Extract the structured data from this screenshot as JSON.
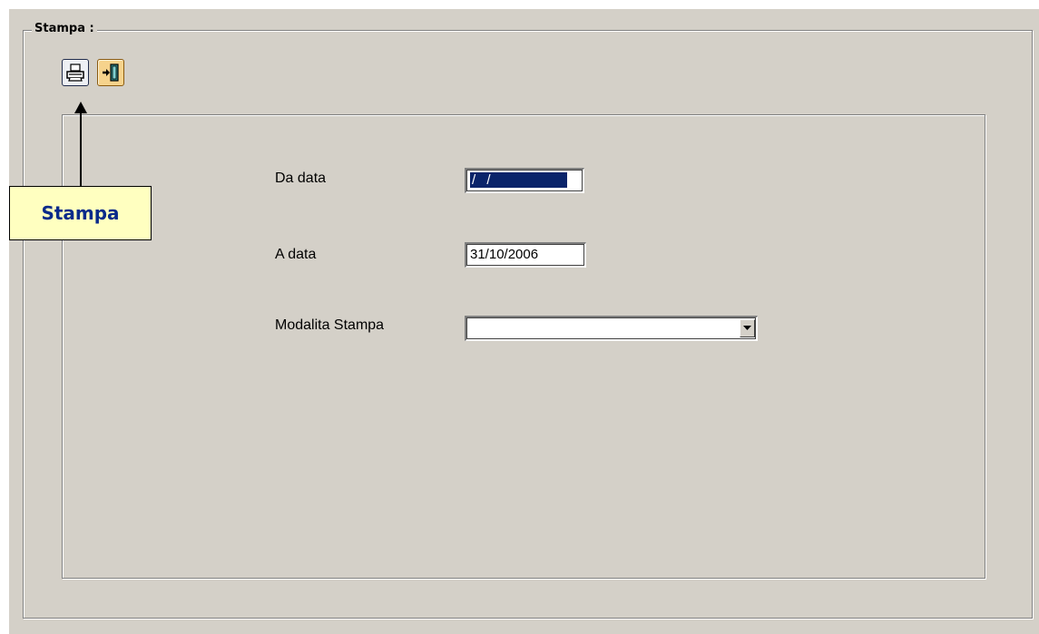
{
  "group": {
    "title": "Stampa :"
  },
  "toolbar": {
    "print_icon": "printer-icon",
    "exit_icon": "exit-door-icon"
  },
  "form": {
    "da_data_label": "Da data",
    "da_data_value": "  /  /    ",
    "a_data_label": "A data",
    "a_data_value": "31/10/2006",
    "modalita_label": "Modalita Stampa",
    "modalita_value": ""
  },
  "callout": {
    "text": "Stampa"
  },
  "colors": {
    "window_bg": "#d4d0c8",
    "selection": "#0a246a",
    "callout_bg": "#ffffc0",
    "callout_text": "#0a2a8a"
  }
}
